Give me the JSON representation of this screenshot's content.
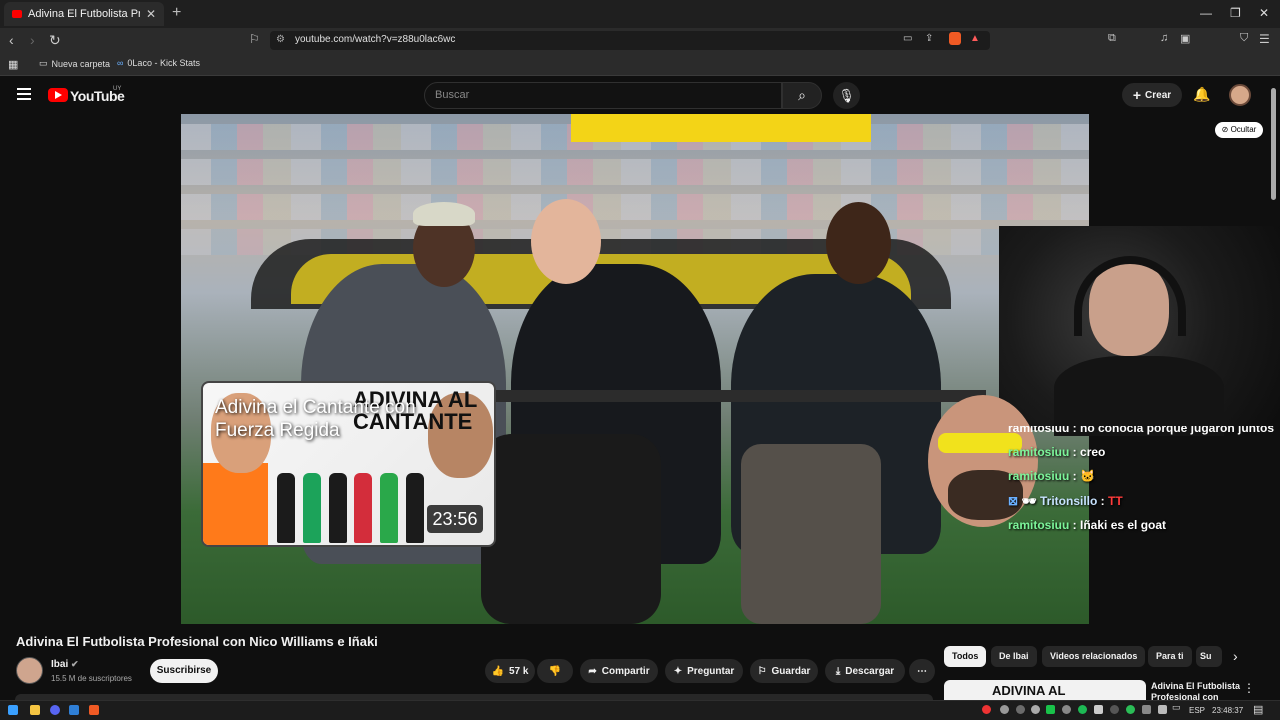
{
  "browser": {
    "tab_title": "Adivina El Futbolista Profesional",
    "tab_close": "✕",
    "new_tab": "+",
    "url": "youtube.com/watch?v=z88u0lac6wc",
    "bookmarks": [
      {
        "label": "Nueva carpeta",
        "icon": "folder-icon"
      },
      {
        "label": "0Laco - Kick Stats",
        "icon": "kick-stats-icon"
      }
    ]
  },
  "youtube": {
    "logo_text": "YouTube",
    "country_code": "UY",
    "search_placeholder": "Buscar",
    "create_label": "Crear",
    "hide_label": "Ocultar"
  },
  "video": {
    "title": "Adivina El Futbolista Profesional con Nico Williams e Iñaki",
    "overlay_card": {
      "title": "Adivina el Cantante con Fuerza Regida",
      "duration": "23:56",
      "thumb_text": "ADIVINA AL CANTANTE"
    }
  },
  "chat": [
    {
      "text": "ramitosiuu : no conocía porque jugaron juntos",
      "cut": true
    },
    {
      "user": "ramitosiuu",
      "message": "creo"
    },
    {
      "user": "ramitosiuu",
      "message": "🐱"
    },
    {
      "user": "Tritonsillo",
      "message": "TT",
      "user_color": "#c7e3ff"
    },
    {
      "user": "ramitosiuu",
      "message": "Iñaki es el goat"
    }
  ],
  "channel": {
    "name": "Ibai",
    "verified": true,
    "subscribers": "15.5 M de suscriptores",
    "subscribe_label": "Suscribirse"
  },
  "actions": {
    "likes": "57 k",
    "share": "Compartir",
    "ask": "Preguntar",
    "save": "Guardar",
    "download": "Descargar"
  },
  "chips": [
    "Todos",
    "De Ibai",
    "Videos relacionados",
    "Para ti",
    "Su"
  ],
  "recommended": {
    "thumb_text": "ADIVINA AL",
    "title": "Adivina El Futbolista Profesional con"
  },
  "taskbar": {
    "language": "ESP",
    "time": "23:48:37"
  },
  "colors": {
    "youtube_red": "#ff0000",
    "background": "#0f0f0f",
    "chat_username": "#7cf59a"
  }
}
